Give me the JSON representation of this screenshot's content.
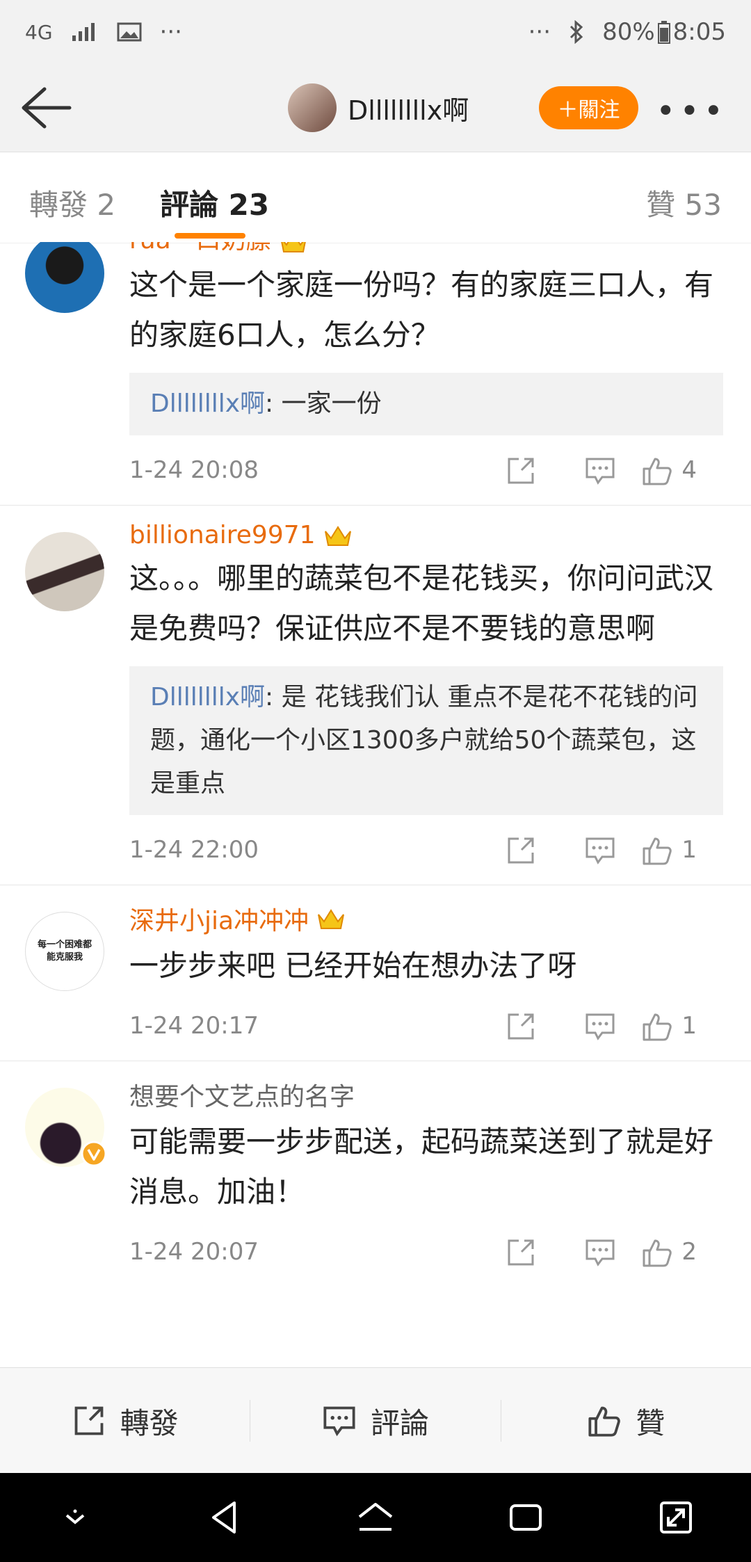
{
  "status_bar": {
    "left_net": "4G",
    "left_dots": "···",
    "right_dots": "···",
    "battery": "80%",
    "time": "8:05"
  },
  "header": {
    "username": "Dllllllllx啊",
    "follow_label": "＋關注",
    "more": "•••"
  },
  "tabs": [
    {
      "label": "轉發 2"
    },
    {
      "label": "評論 23"
    },
    {
      "label": "贊 53"
    }
  ],
  "comments": [
    {
      "name": "rua一口奶膘",
      "text": "这个是一个家庭一份吗？有的家庭三口人，有的家庭6口人，怎么分？",
      "reply_name": "Dllllllllx啊",
      "reply_text": ": 一家一份",
      "time": "1-24 20:08",
      "likes": "4"
    },
    {
      "name": "billionaire9971",
      "text": "这。。。哪里的蔬菜包不是花钱买，你问问武汉是免费吗？保证供应不是不要钱的意思啊",
      "reply_name": "Dllllllllx啊",
      "reply_text": ": 是 花钱我们认 重点不是花不花钱的问题，通化一个小区1300多户就给50个蔬菜包，这是重点",
      "time": "1-24 22:00",
      "likes": "1"
    },
    {
      "name": "深井小jia冲冲冲",
      "avatar_text": "每一个困难都能克服我",
      "text": "一步步来吧 已经开始在想办法了呀",
      "time": "1-24 20:17",
      "likes": "1"
    },
    {
      "name": "想要个文艺点的名字",
      "text": "可能需要一步步配送，起码蔬菜送到了就是好消息。加油！",
      "time": "1-24 20:07",
      "likes": "2"
    }
  ],
  "bottom_bar": {
    "repost": "轉發",
    "comment": "評論",
    "like": "贊"
  },
  "colors": {
    "accent": "#ff8200",
    "name_orange": "#e86b0e",
    "reply_name": "#5a7fb5"
  }
}
